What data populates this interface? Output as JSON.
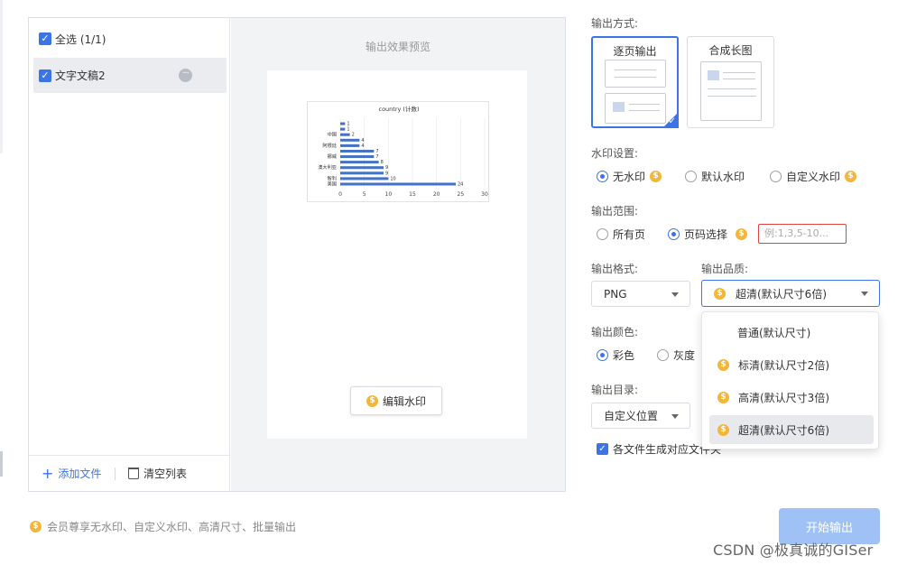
{
  "files": {
    "select_all_label": "全选 (1/1)",
    "items": [
      {
        "name": "文字文稿2"
      }
    ],
    "add_label": "添加文件",
    "clear_label": "清空列表"
  },
  "preview": {
    "title": "输出效果预览",
    "edit_watermark_label": "编辑水印"
  },
  "chart_data": {
    "type": "bar",
    "orientation": "horizontal",
    "title": "country (计数)",
    "categories": [
      "美国",
      "智利",
      "",
      "澳大利亚",
      "",
      "挪威",
      "",
      "阿根廷",
      "",
      "中国",
      ""
    ],
    "values": [
      24,
      10,
      9,
      9,
      8,
      7,
      7,
      4,
      4,
      2,
      1,
      1
    ],
    "xticks": [
      "0",
      "5",
      "10",
      "15",
      "20",
      "25",
      "30"
    ],
    "xlim": [
      0,
      30
    ],
    "bar_color": "#4472c4",
    "grid": true
  },
  "output_mode": {
    "label": "输出方式:",
    "options": [
      "逐页输出",
      "合成长图"
    ],
    "selected": 0
  },
  "watermark": {
    "label": "水印设置:",
    "options": [
      "无水印",
      "默认水印",
      "自定义水印"
    ]
  },
  "range": {
    "label": "输出范围:",
    "options": [
      "所有页",
      "页码选择"
    ],
    "placeholder": "例:1,3,5-10..."
  },
  "format": {
    "label": "输出格式:",
    "value": "PNG"
  },
  "quality": {
    "label": "输出品质:",
    "value": "超清(默认尺寸6倍)",
    "options": [
      "普通(默认尺寸)",
      "标清(默认尺寸2倍)",
      "高清(默认尺寸3倍)",
      "超清(默认尺寸6倍)"
    ]
  },
  "color": {
    "label": "输出颜色:",
    "options": [
      "彩色",
      "灰度"
    ]
  },
  "dir": {
    "label": "输出目录:",
    "value": "自定义位置"
  },
  "subfolder_label": "各文件生成对应文件夹",
  "footer": {
    "vip_note": "会员尊享无水印、自定义水印、高清尺寸、批量输出",
    "start_label": "开始输出"
  },
  "corner_watermark": "CSDN @极真诚的GISer",
  "colors": {
    "accent": "#3b74e6",
    "coin": "#f3b53a",
    "disabled_button": "#9fc1f5",
    "error_border": "#e0443e"
  }
}
